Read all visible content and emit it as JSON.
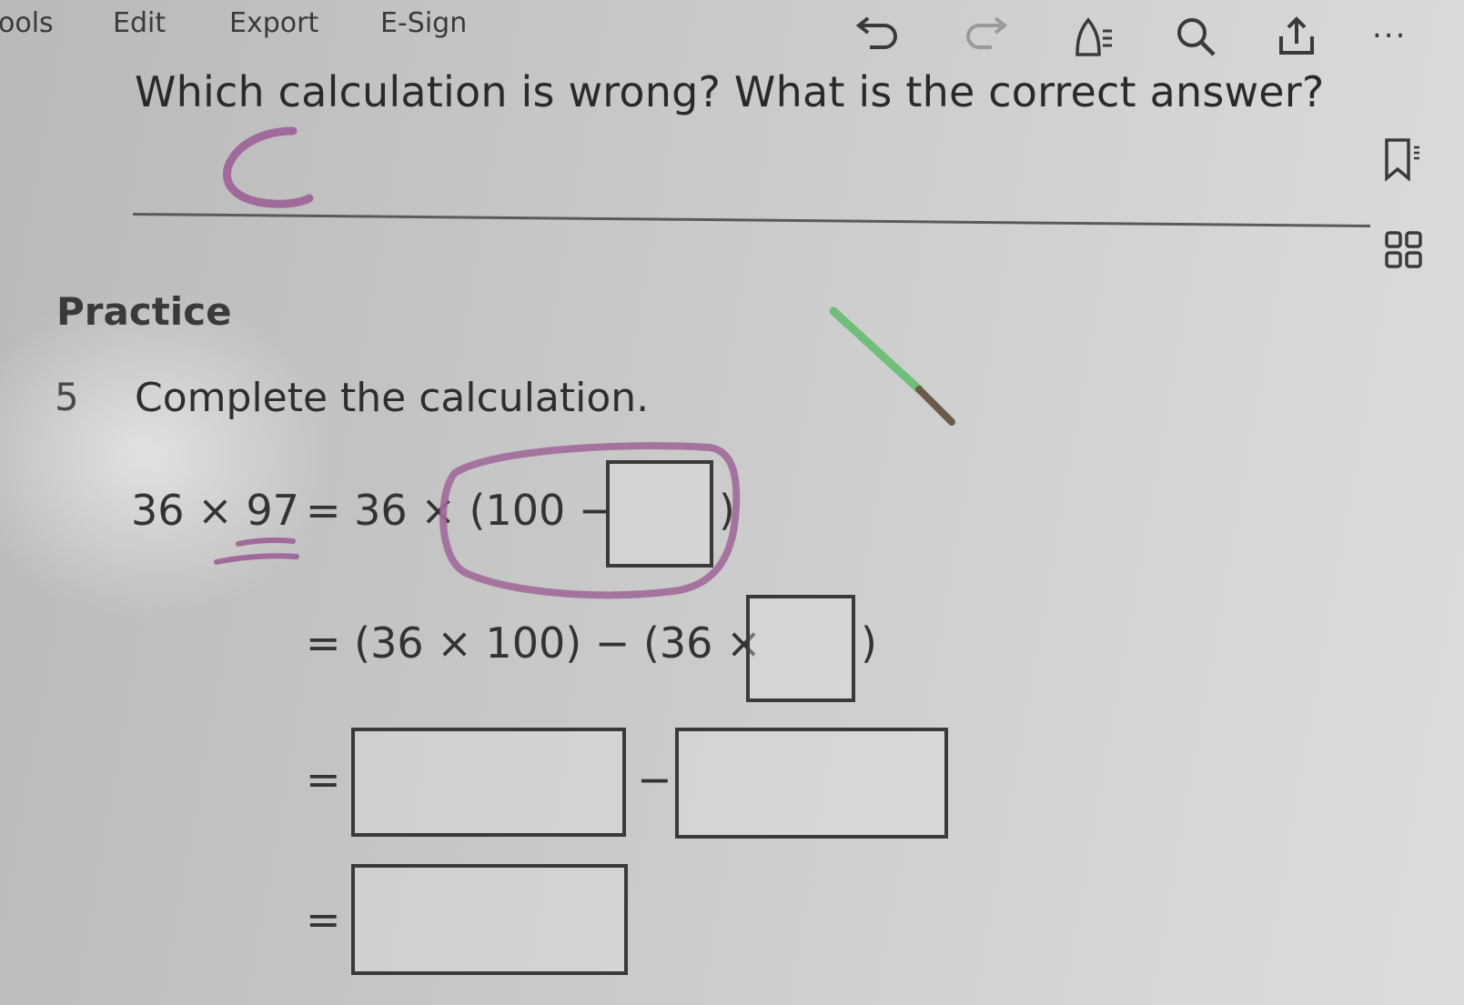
{
  "toolbar": {
    "menu": [
      "ools",
      "Edit",
      "Export",
      "E-Sign"
    ],
    "icons": [
      "undo-icon",
      "redo-icon",
      "read-aloud-icon",
      "search-icon",
      "share-icon",
      "more-icon"
    ],
    "more_label": "..."
  },
  "side_icons": [
    "bookmark-icon",
    "thumbnails-grid-icon"
  ],
  "question": {
    "text": "Which calculation is wrong? What is the correct answer?",
    "handwritten_answer": "C"
  },
  "practice": {
    "heading": "Practice",
    "number": "5",
    "instruction": "Complete the calculation.",
    "line1": {
      "left": "36 × 97",
      "right_prefix": "= 36 × (100 −",
      "close": ")"
    },
    "line2": {
      "prefix": "= (36 × 100) − (36 ×",
      "close": ")"
    },
    "line3": {
      "eq": "=",
      "minus": "−"
    },
    "line4": {
      "eq": "="
    }
  },
  "colors": {
    "ink_pen": "#a06a9a",
    "highlighter": "#6fbf7a"
  }
}
